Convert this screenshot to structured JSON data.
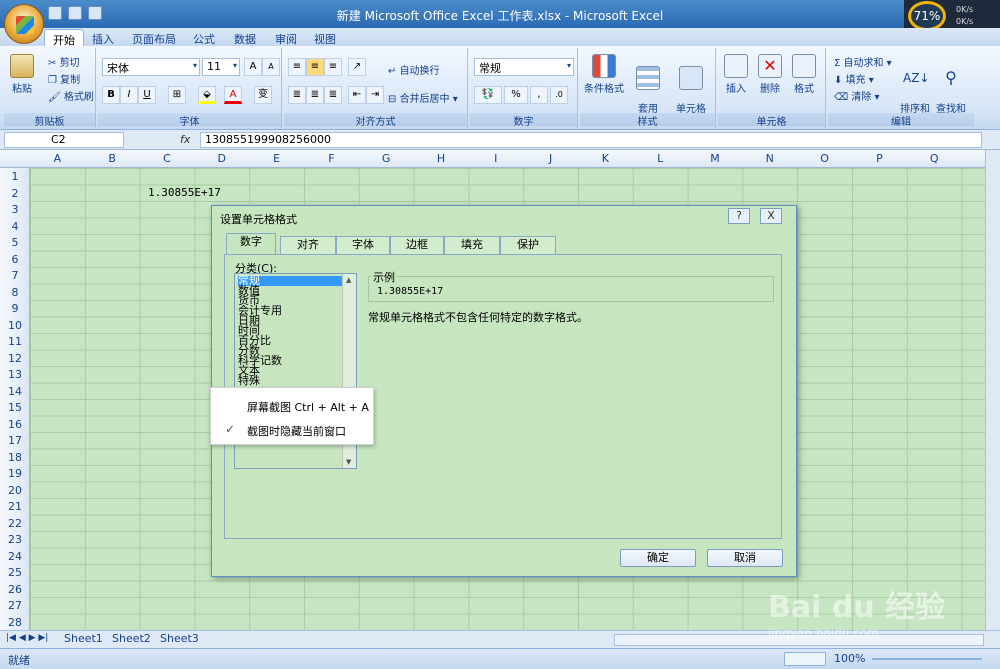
{
  "window": {
    "title": "新建 Microsoft Office Excel 工作表.xlsx - Microsoft Excel"
  },
  "tray": {
    "cpu": "71%",
    "up": "0K/s",
    "down": "0K/s"
  },
  "tabs": [
    "开始",
    "插入",
    "页面布局",
    "公式",
    "数据",
    "审阅",
    "视图"
  ],
  "ribbon": {
    "clipboard": {
      "label": "剪贴板",
      "paste": "粘贴",
      "cut": "剪切",
      "copy": "复制",
      "format_painter": "格式刷"
    },
    "font": {
      "label": "字体",
      "name": "宋体",
      "size": "11",
      "bold": "B",
      "italic": "I",
      "underline": "U",
      "grow": "A",
      "shrink": "A",
      "color": "A",
      "wen": "变"
    },
    "alignment": {
      "label": "对齐方式",
      "wrap": "自动换行",
      "merge": "合并后居中"
    },
    "number": {
      "label": "数字",
      "format": "常规",
      "percent": "%"
    },
    "styles": {
      "label": "样式",
      "conditional": "条件格式",
      "table_format": "套用\n表格格式",
      "cell_style": "单元格\n样式"
    },
    "cells": {
      "label": "单元格",
      "insert": "插入",
      "delete": "删除",
      "format": "格式"
    },
    "editing": {
      "label": "编辑",
      "autosum": "自动求和",
      "fill": "填充",
      "clear": "清除",
      "sort": "排序和\n筛选",
      "find": "查找和\n选择"
    }
  },
  "formula": {
    "cell": "C2",
    "fx": "fx",
    "value": "130855199908256000"
  },
  "columns": [
    "A",
    "B",
    "C",
    "D",
    "E",
    "F",
    "G",
    "H",
    "I",
    "J",
    "K",
    "L",
    "M",
    "N",
    "O",
    "P",
    "Q"
  ],
  "rows": [
    "1",
    "2",
    "3",
    "4",
    "5",
    "6",
    "7",
    "8",
    "9",
    "10",
    "11",
    "12",
    "13",
    "14",
    "15",
    "16",
    "17",
    "18",
    "19",
    "20",
    "21",
    "22",
    "23",
    "24",
    "25",
    "26",
    "27",
    "28"
  ],
  "cell_c2": "1.30855E+17",
  "sheets": [
    "Sheet1",
    "Sheet2",
    "Sheet3"
  ],
  "status": {
    "ready": "就绪",
    "zoom": "100%"
  },
  "dialog": {
    "title": "设置单元格格式",
    "help": "?",
    "close": "X",
    "tabs": [
      "数字",
      "对齐",
      "字体",
      "边框",
      "填充",
      "保护"
    ],
    "category_label": "分类(C):",
    "categories": [
      "常规",
      "数值",
      "货币",
      "会计专用",
      "日期",
      "时间",
      "百分比",
      "分数",
      "科学记数",
      "文本",
      "特殊"
    ],
    "sample_label": "示例",
    "sample_value": "1.30855E+17",
    "description": "常规单元格格式不包含任何特定的数字格式。",
    "ok": "确定",
    "cancel": "取消"
  },
  "context_menu": {
    "item1": "屏幕截图 Ctrl + Alt + A",
    "item2": "截图时隐藏当前窗口",
    "check": "✓"
  },
  "watermark": {
    "brand": "Bai du 经验",
    "url": "jingyan.baidu.com"
  }
}
